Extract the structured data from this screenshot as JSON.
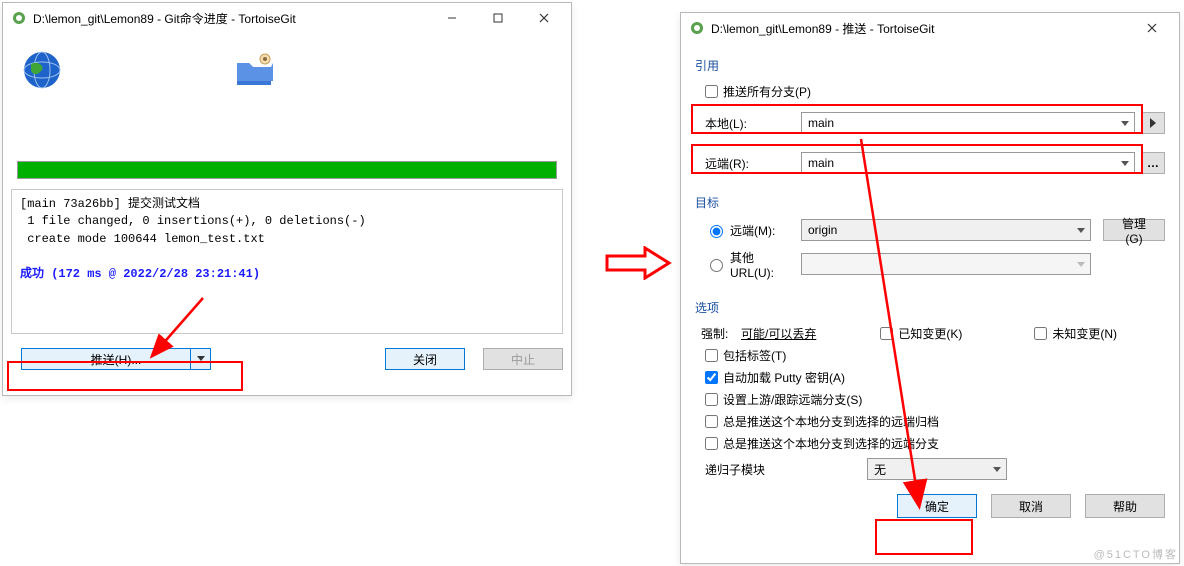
{
  "win1": {
    "title": "D:\\lemon_git\\Lemon89 - Git命令进度 - TortoiseGit",
    "log_line1": "[main 73a26bb] 提交测试文档",
    "log_line2": " 1 file changed, 0 insertions(+), 0 deletions(-)",
    "log_line3": " create mode 100644 lemon_test.txt",
    "log_success": "成功 (172 ms @ 2022/2/28 23:21:41)",
    "push_btn": "推送(H)...",
    "close_btn": "关闭",
    "abort_btn": "中止"
  },
  "win2": {
    "title": "D:\\lemon_git\\Lemon89 - 推送 - TortoiseGit",
    "group_ref": "引用",
    "push_all_branches": "推送所有分支(P)",
    "local_label": "本地(L):",
    "local_value": "main",
    "remote_label": "远端(R):",
    "remote_value": "main",
    "group_target": "目标",
    "target_remote_label": "远端(M):",
    "target_remote_value": "origin",
    "manage_btn": "管理(G)",
    "other_url_label": "其他URL(U):",
    "group_options": "选项",
    "force_label": "强制: ",
    "force_opt1": "可能/可以丢弃",
    "known_changes": "已知变更(K)",
    "unknown_changes": "未知变更(N)",
    "include_tags": "包括标签(T)",
    "auto_putty": "自动加载 Putty 密钥(A)",
    "set_upstream": "设置上游/跟踪远端分支(S)",
    "always_push_archive": "总是推送这个本地分支到选择的远端归档",
    "always_push_branch": "总是推送这个本地分支到选择的远端分支",
    "submodule_label": "递归子模块",
    "submodule_value": "无",
    "ok_btn": "确定",
    "cancel_btn": "取消",
    "help_btn": "帮助"
  },
  "watermark": "@51CTO博客"
}
